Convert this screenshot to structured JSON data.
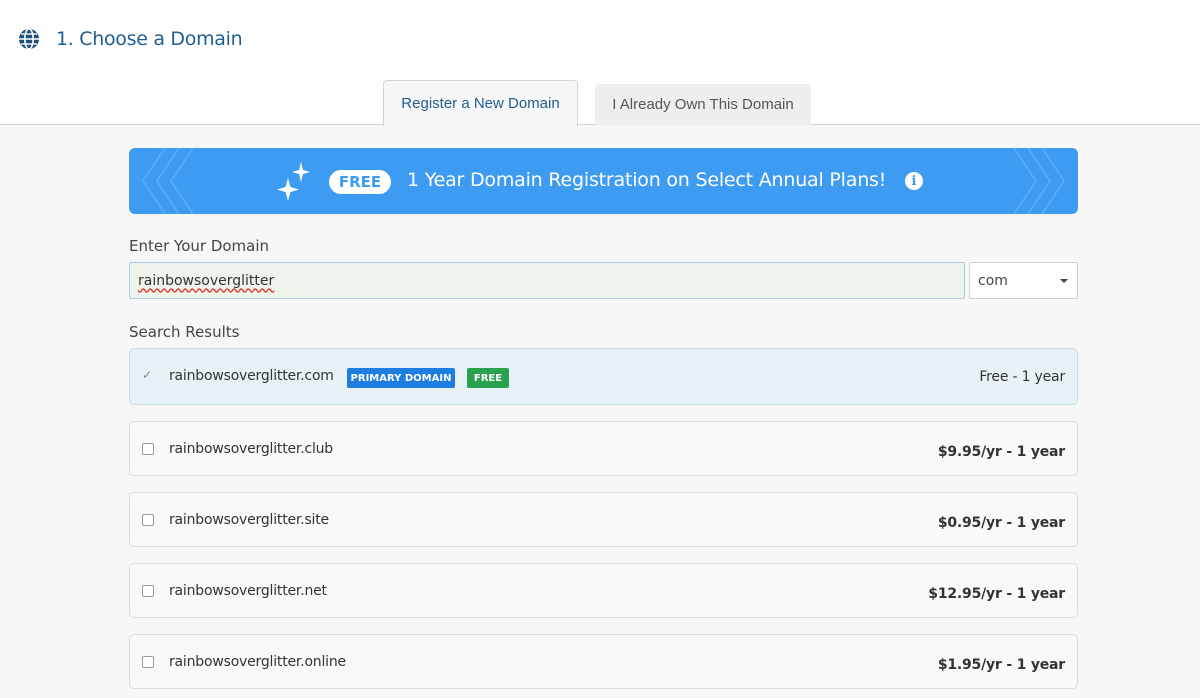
{
  "header": {
    "step_title": "1. Choose a Domain",
    "globe_icon": "globe-icon"
  },
  "tabs": [
    {
      "label": "Register a New Domain",
      "active": true
    },
    {
      "label": "I Already Own This Domain",
      "active": false
    }
  ],
  "banner": {
    "pill": "FREE",
    "text": "1 Year Domain Registration on Select Annual Plans!",
    "info": "i",
    "color": "#3d9bf2"
  },
  "form": {
    "enter_label": "Enter Your Domain",
    "domain_value": "rainbowsoverglitter",
    "tld_value": "com"
  },
  "results": {
    "label": "Search Results",
    "items": [
      {
        "name": "rainbowsoverglitter.com",
        "badges": [
          "PRIMARY DOMAIN",
          "FREE"
        ],
        "price": "Free - 1 year",
        "checked": true,
        "check_glyph": "✓"
      },
      {
        "name": "rainbowsoverglitter.club",
        "price": "$9.95/yr - 1 year",
        "checked": false
      },
      {
        "name": "rainbowsoverglitter.site",
        "price": "$0.95/yr - 1 year",
        "checked": false
      },
      {
        "name": "rainbowsoverglitter.net",
        "price": "$12.95/yr - 1 year",
        "checked": false
      },
      {
        "name": "rainbowsoverglitter.online",
        "price": "$1.95/yr - 1 year",
        "checked": false
      }
    ]
  }
}
